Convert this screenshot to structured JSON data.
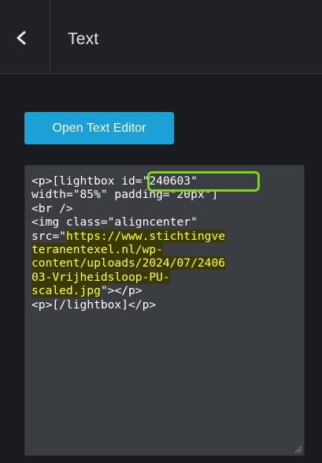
{
  "header": {
    "title": "Text",
    "back_icon": "chevron-left-icon"
  },
  "panel": {
    "open_editor_label": "Open Text Editor",
    "editor": {
      "lines": [
        "<p>[lightbox id=\"240603\"",
        "width=\"85%\" padding=\"20px\"]",
        "<br />",
        "<img class=\"aligncenter\"",
        "src=\"",
        "https://www.stichtingve",
        "teranentexel.nl/wp-",
        "content/uploads/2024/07/2406",
        "03-Vrijheidsloop-PU-",
        "scaled.jpg",
        "\"></p>",
        "<p>[/lightbox]</p>"
      ]
    }
  },
  "colors": {
    "accent_button": "#1ba1d6",
    "highlight_text": "#ffff3c",
    "annotation_outline": "#7ed321"
  }
}
